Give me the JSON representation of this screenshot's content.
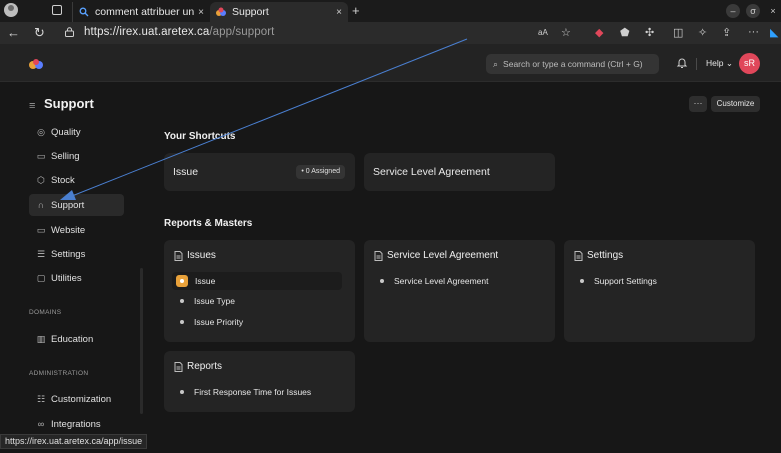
{
  "browser": {
    "tabs": [
      {
        "title": "comment attribuer un tic",
        "close": "×"
      },
      {
        "title": "Support",
        "close": "×"
      }
    ],
    "new_tab": "+",
    "url_host": "https://irex.uat.aretex.ca",
    "url_path": "/app/support",
    "window_buttons": [
      "–",
      "σ",
      "×"
    ]
  },
  "navbar": {
    "search_placeholder": "Search or type a command (Ctrl + G)",
    "help_label": "Help ⌄",
    "avatar_initials": "sR"
  },
  "page": {
    "title": "Support",
    "more_label": "···",
    "customize_label": "Customize"
  },
  "sidebar": {
    "items": [
      {
        "label": "Quality"
      },
      {
        "label": "Selling"
      },
      {
        "label": "Stock"
      },
      {
        "label": "Support"
      },
      {
        "label": "Website"
      },
      {
        "label": "Settings"
      },
      {
        "label": "Utilities"
      }
    ],
    "domains_heading": "DOMAINS",
    "domains_items": [
      {
        "label": "Education"
      }
    ],
    "admin_heading": "ADMINISTRATION",
    "admin_items": [
      {
        "label": "Customization"
      },
      {
        "label": "Integrations"
      }
    ]
  },
  "shortcuts": {
    "heading": "Your Shortcuts",
    "items": [
      {
        "label": "Issue",
        "badge": "• 0 Assigned"
      },
      {
        "label": "Service Level Agreement"
      }
    ]
  },
  "reports": {
    "heading": "Reports & Masters",
    "cards": [
      {
        "title": "Issues",
        "links": [
          "Issue",
          "Issue Type",
          "Issue Priority"
        ]
      },
      {
        "title": "Service Level Agreement",
        "links": [
          "Service Level Agreement"
        ]
      },
      {
        "title": "Settings",
        "links": [
          "Support Settings"
        ]
      },
      {
        "title": "Reports",
        "links": [
          "First Response Time for Issues"
        ]
      }
    ]
  },
  "status_bar": {
    "url": "https://irex.uat.aretex.ca/app/issue"
  },
  "colors": {
    "accent_orange": "#e8a13a",
    "avatar_bg": "#e0475a",
    "cursor_blue": "#4a7fd0"
  }
}
